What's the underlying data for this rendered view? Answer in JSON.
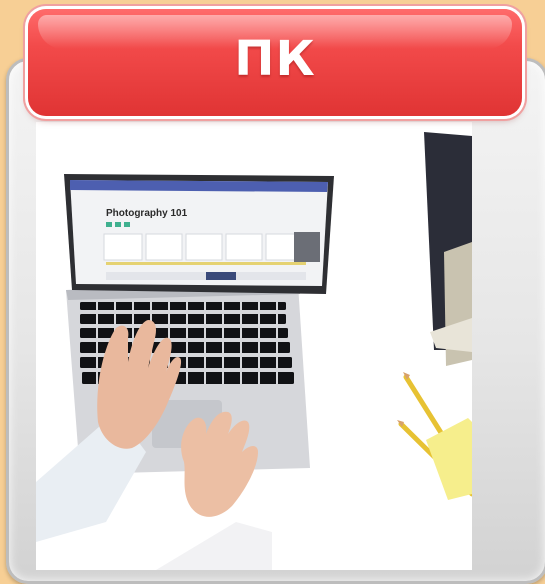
{
  "banner": {
    "title": "ПК"
  },
  "screen": {
    "course_title": "Photography 101"
  },
  "colors": {
    "background": "#f7cf95",
    "banner_red": "#f24a4a",
    "card_gray": "#e6e6e6"
  }
}
